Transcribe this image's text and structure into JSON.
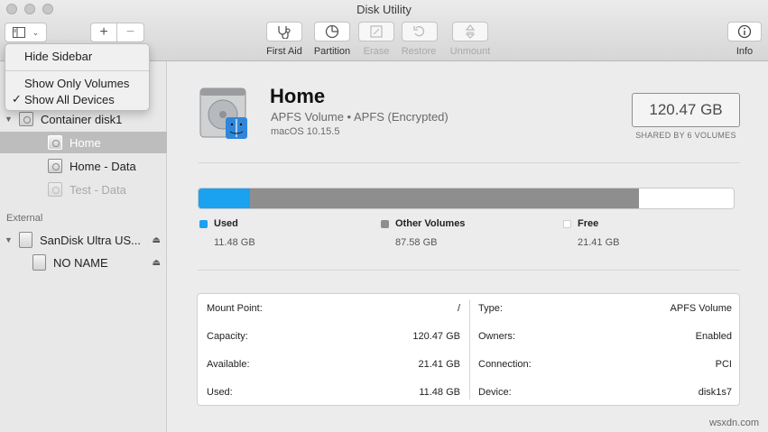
{
  "window": {
    "title": "Disk Utility"
  },
  "toolbar": {
    "view_icon": "sidebar-icon",
    "add_label": "+",
    "remove_label": "−",
    "buttons": [
      {
        "label": "First Aid",
        "icon": "stethoscope-icon",
        "enabled": true
      },
      {
        "label": "Partition",
        "icon": "pie-icon",
        "enabled": true
      },
      {
        "label": "Erase",
        "icon": "erase-icon",
        "enabled": false
      },
      {
        "label": "Restore",
        "icon": "restore-icon",
        "enabled": false
      },
      {
        "label": "Unmount",
        "icon": "unmount-icon",
        "enabled": false
      }
    ],
    "info_label": "Info"
  },
  "view_menu": {
    "items": [
      {
        "label": "Hide Sidebar",
        "checked": false
      },
      {
        "label": "Show Only Volumes",
        "checked": false
      },
      {
        "label": "Show All Devices",
        "checked": true
      }
    ],
    "check_mark": "✓"
  },
  "sidebar": {
    "internal_items": [
      {
        "label": "Container disk1",
        "selected": false,
        "dimmed": false
      },
      {
        "label": "Home",
        "selected": true,
        "dimmed": false
      },
      {
        "label": "Home - Data",
        "selected": false,
        "dimmed": false
      },
      {
        "label": "Test - Data",
        "selected": false,
        "dimmed": true
      }
    ],
    "external_heading": "External",
    "external_items": [
      {
        "label": "SanDisk Ultra US...",
        "eject": true
      },
      {
        "label": "NO NAME",
        "eject": true
      }
    ],
    "disclosure": "▼",
    "eject_glyph": "⏏"
  },
  "volume": {
    "name": "Home",
    "type": "APFS Volume • APFS (Encrypted)",
    "os": "macOS 10.15.5",
    "size": "120.47 GB",
    "shared": "SHARED BY 6 VOLUMES"
  },
  "usage": {
    "fractions": {
      "used": 0.0953,
      "other": 0.727,
      "free": 0.1777
    },
    "legend": [
      {
        "label": "Used",
        "value": "11.48 GB",
        "color": "#1aa1f0"
      },
      {
        "label": "Other Volumes",
        "value": "87.58 GB",
        "color": "#8e8e8e"
      },
      {
        "label": "Free",
        "value": "21.41 GB",
        "color": "#ffffff"
      }
    ]
  },
  "info": {
    "left": [
      {
        "key": "Mount Point:",
        "value": "/"
      },
      {
        "key": "Capacity:",
        "value": "120.47 GB"
      },
      {
        "key": "Available:",
        "value": "21.41 GB"
      },
      {
        "key": "Used:",
        "value": "11.48 GB"
      }
    ],
    "right": [
      {
        "key": "Type:",
        "value": "APFS Volume"
      },
      {
        "key": "Owners:",
        "value": "Enabled"
      },
      {
        "key": "Connection:",
        "value": "PCI"
      },
      {
        "key": "Device:",
        "value": "disk1s7"
      }
    ]
  },
  "watermark": "wsxdn.com"
}
